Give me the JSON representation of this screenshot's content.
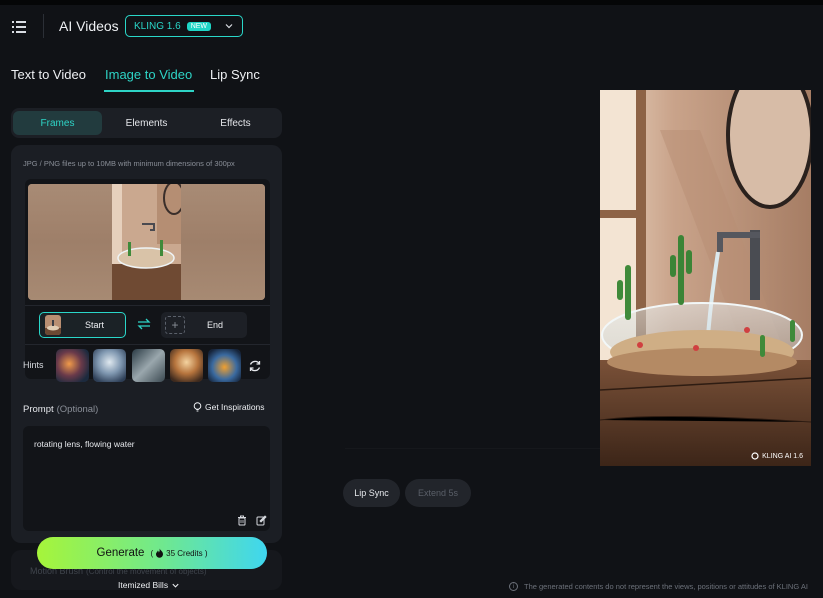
{
  "header": {
    "title": "AI Videos",
    "model_label": "KLING 1.6",
    "model_badge": "NEW"
  },
  "mode_tabs": [
    {
      "label": "Text to Video",
      "active": false
    },
    {
      "label": "Image to Video",
      "active": true
    },
    {
      "label": "Lip Sync",
      "active": false
    }
  ],
  "segments": [
    {
      "label": "Frames",
      "active": true
    },
    {
      "label": "Elements",
      "active": false
    },
    {
      "label": "Effects",
      "active": false
    }
  ],
  "upload": {
    "hint": "JPG / PNG files up to 10MB with minimum dimensions of 300px",
    "start_label": "Start",
    "end_label": "End",
    "hints_label": "Hints"
  },
  "prompt": {
    "label": "Prompt",
    "optional": "(Optional)",
    "inspirations": "Get Inspirations",
    "value": "rotating lens, flowing water"
  },
  "motion_brush": {
    "label": "Motion Brush",
    "sub": "(Control the movement of objects)"
  },
  "generate": {
    "label": "Generate",
    "credits": "35 Credits"
  },
  "bills_label": "Itemized Bills",
  "result": {
    "watermark": "KLING AI 1.6"
  },
  "actions": {
    "lip_sync": "Lip Sync",
    "extend": "Extend 5s"
  },
  "disclaimer": "The generated contents do not represent the views, positions or attitudes of KLING AI",
  "colors": {
    "accent": "#2ed4c6",
    "background": "#101216",
    "panel": "#1b1e24"
  }
}
